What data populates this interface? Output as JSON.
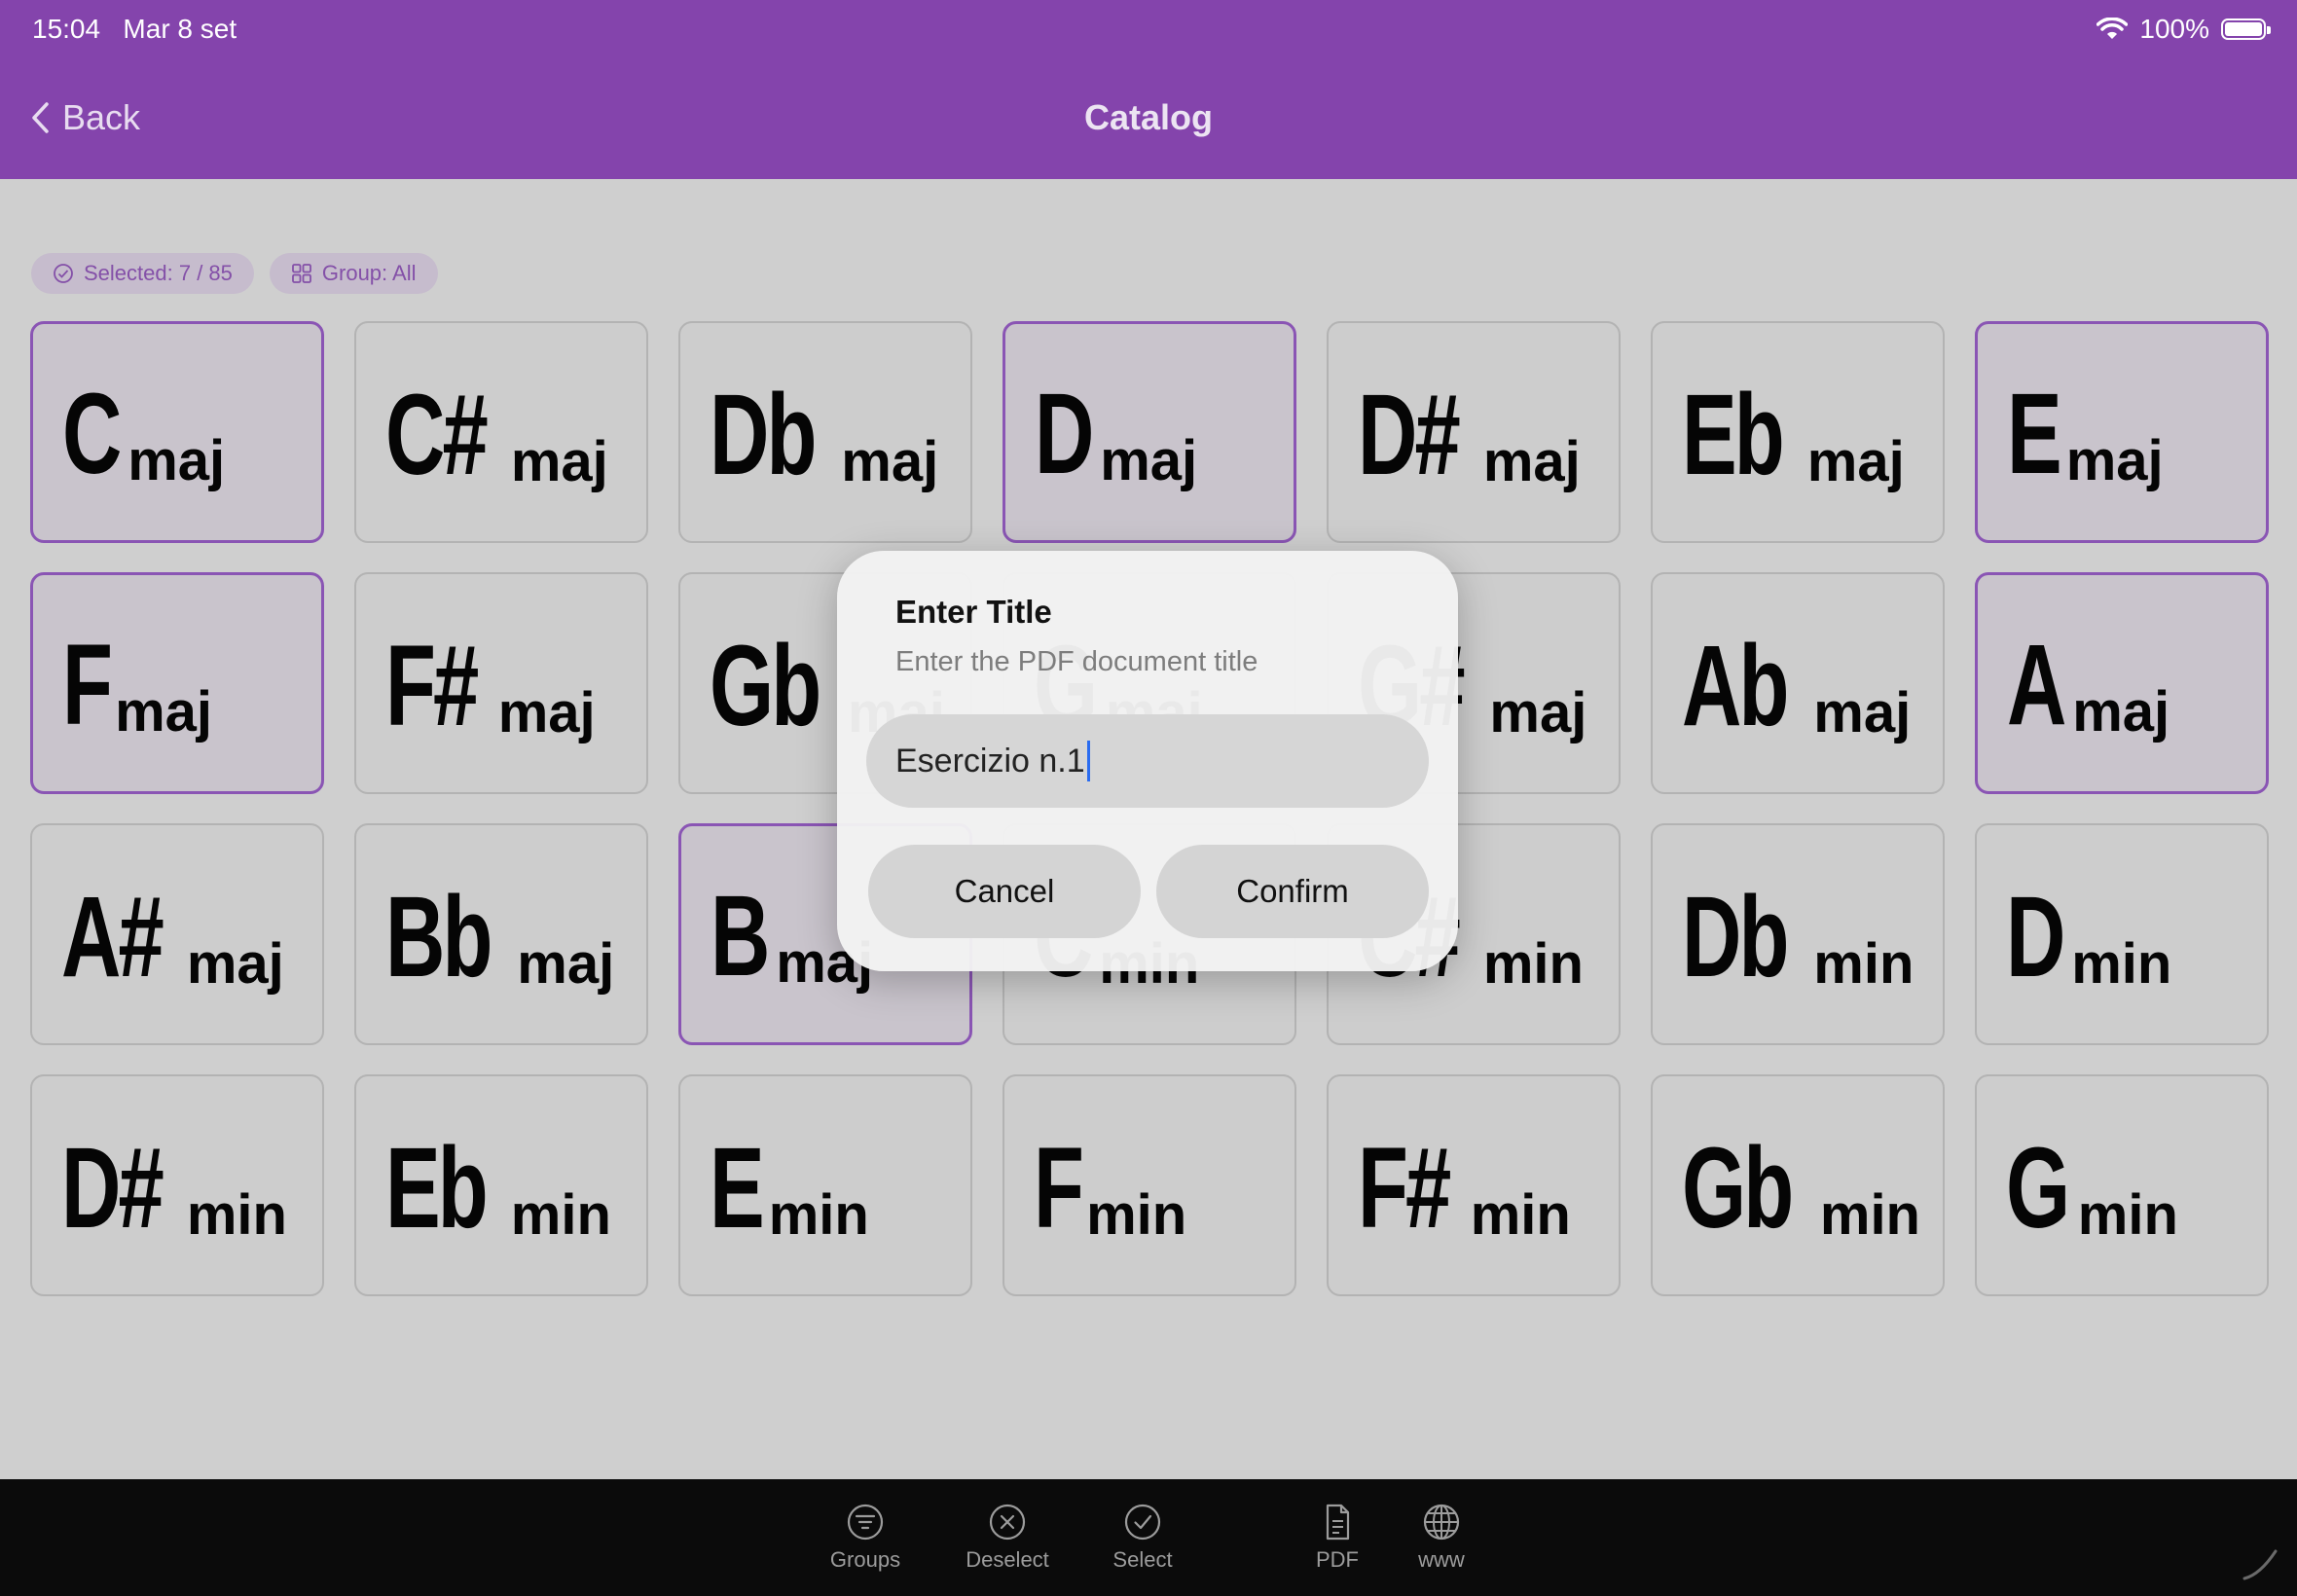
{
  "status": {
    "time": "15:04",
    "date": "Mar 8 set",
    "battery": "100%"
  },
  "nav": {
    "back_label": "Back",
    "title": "Catalog"
  },
  "chips": {
    "selected": "Selected: 7 / 85",
    "group": "Group: All"
  },
  "chords": [
    {
      "root": "C",
      "quality": "maj",
      "selected": true
    },
    {
      "root": "C#",
      "quality": "maj",
      "selected": false
    },
    {
      "root": "Db",
      "quality": "maj",
      "selected": false
    },
    {
      "root": "D",
      "quality": "maj",
      "selected": true
    },
    {
      "root": "D#",
      "quality": "maj",
      "selected": false
    },
    {
      "root": "Eb",
      "quality": "maj",
      "selected": false
    },
    {
      "root": "E",
      "quality": "maj",
      "selected": true
    },
    {
      "root": "F",
      "quality": "maj",
      "selected": true
    },
    {
      "root": "F#",
      "quality": "maj",
      "selected": false
    },
    {
      "root": "Gb",
      "quality": "maj",
      "selected": false
    },
    {
      "root": "G",
      "quality": "maj",
      "selected": false
    },
    {
      "root": "G#",
      "quality": "maj",
      "selected": false
    },
    {
      "root": "Ab",
      "quality": "maj",
      "selected": false
    },
    {
      "root": "A",
      "quality": "maj",
      "selected": true
    },
    {
      "root": "A#",
      "quality": "maj",
      "selected": false
    },
    {
      "root": "Bb",
      "quality": "maj",
      "selected": false
    },
    {
      "root": "B",
      "quality": "maj",
      "selected": true
    },
    {
      "root": "C",
      "quality": "min",
      "selected": false
    },
    {
      "root": "C#",
      "quality": "min",
      "selected": false
    },
    {
      "root": "Db",
      "quality": "min",
      "selected": false
    },
    {
      "root": "D",
      "quality": "min",
      "selected": false
    },
    {
      "root": "D#",
      "quality": "min",
      "selected": false
    },
    {
      "root": "Eb",
      "quality": "min",
      "selected": false
    },
    {
      "root": "E",
      "quality": "min",
      "selected": false
    },
    {
      "root": "F",
      "quality": "min",
      "selected": false
    },
    {
      "root": "F#",
      "quality": "min",
      "selected": false
    },
    {
      "root": "Gb",
      "quality": "min",
      "selected": false
    },
    {
      "root": "G",
      "quality": "min",
      "selected": false
    }
  ],
  "dialog": {
    "title": "Enter Title",
    "subtitle": "Enter the PDF document title",
    "input_value": "Esercizio n.1",
    "cancel_label": "Cancel",
    "confirm_label": "Confirm"
  },
  "tabbar": {
    "groups": "Groups",
    "deselect": "Deselect",
    "select": "Select",
    "pdf": "PDF",
    "www": "www"
  },
  "colors": {
    "accent": "#8444ac",
    "tabbar": "#0b0b0b"
  }
}
